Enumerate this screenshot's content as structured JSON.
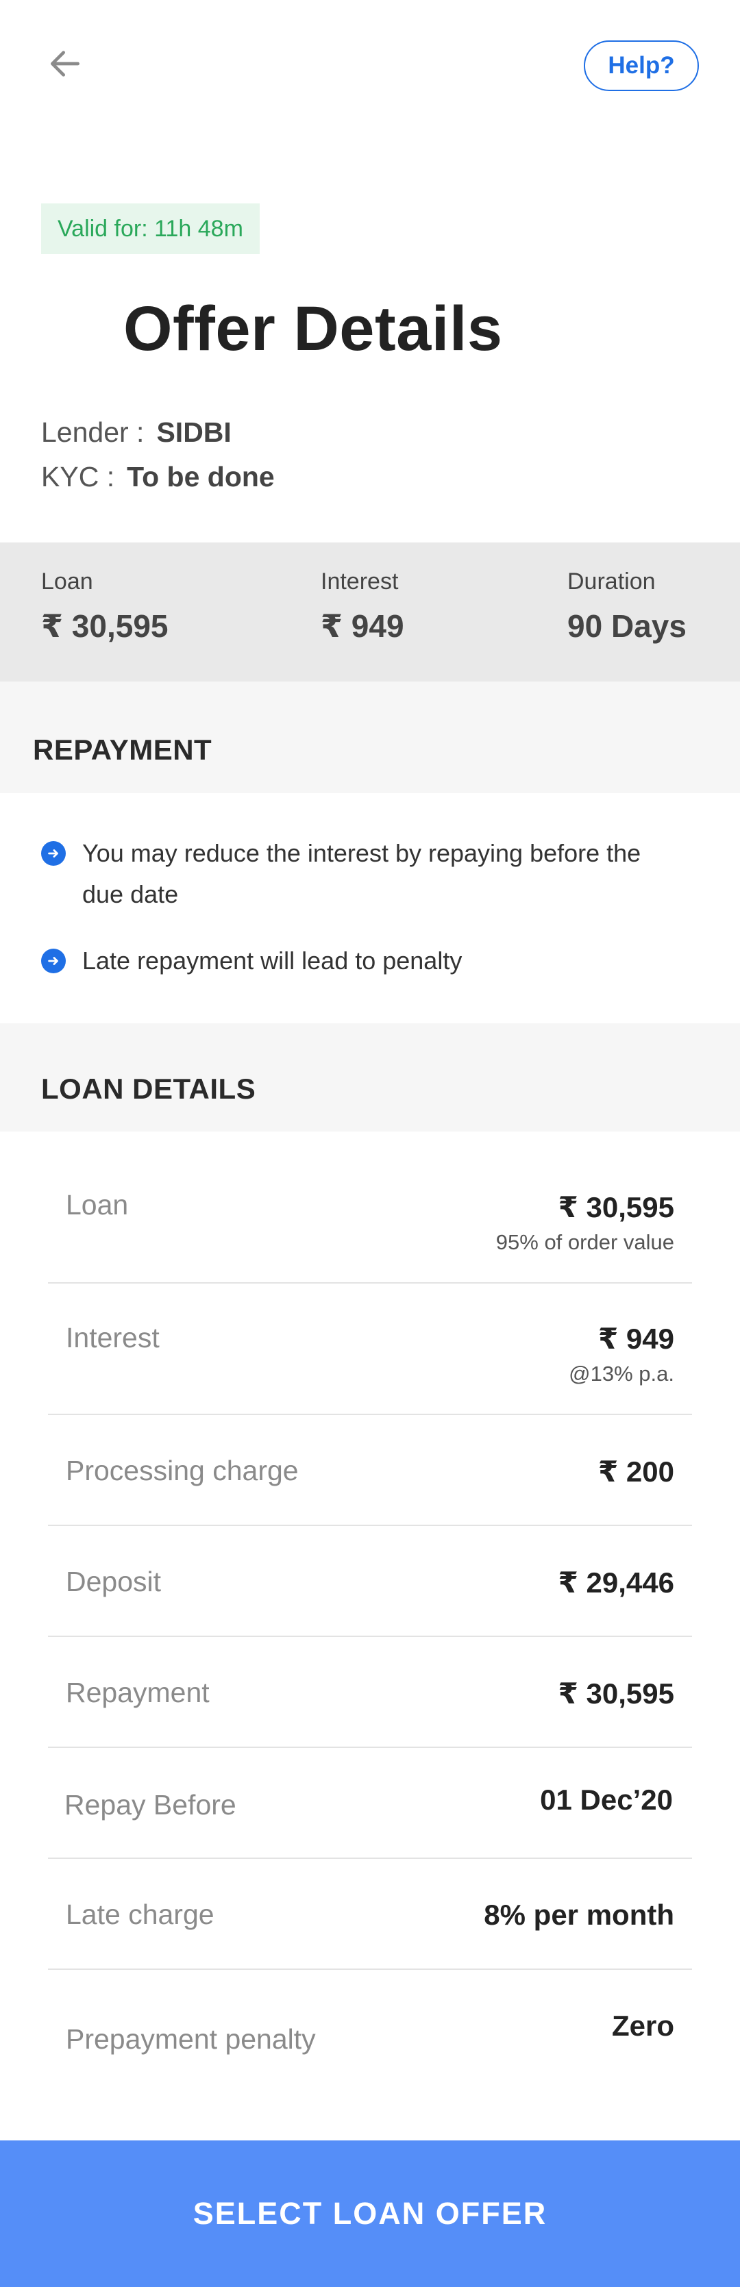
{
  "header": {
    "help_label": "Help?"
  },
  "offer": {
    "validity": "Valid for: 11h 48m",
    "title": "Offer Details",
    "lender_label": "Lender :",
    "lender_value": "SIDBI",
    "kyc_label": "KYC :",
    "kyc_value": "To be done"
  },
  "summary": [
    {
      "label": "Loan",
      "value": "₹ 30,595"
    },
    {
      "label": "Interest",
      "value": "₹ 949"
    },
    {
      "label": "Duration",
      "value": "90 Days"
    }
  ],
  "repayment": {
    "heading": "REPAYMENT",
    "notes": [
      "You may reduce the interest by repaying before the due date",
      "Late repayment will lead to penalty"
    ]
  },
  "loan_details": {
    "heading": "LOAN DETAILS",
    "rows": [
      {
        "label": "Loan",
        "value": "₹ 30,595",
        "sub": "95% of order value"
      },
      {
        "label": "Interest",
        "value": "₹ 949",
        "sub": "@13% p.a."
      },
      {
        "label": "Processing charge",
        "value": "₹ 200"
      },
      {
        "label": "Deposit",
        "value": "₹ 29,446"
      },
      {
        "label": "Repayment",
        "value": "₹ 30,595"
      },
      {
        "label": "Repay Before",
        "value": "01 Dec’20"
      },
      {
        "label": "Late charge",
        "value": "8% per month"
      },
      {
        "label": "Prepayment penalty",
        "value": "Zero"
      }
    ]
  },
  "cta": {
    "label": "SELECT LOAN OFFER"
  },
  "colors": {
    "accent": "#1f6fe5",
    "cta": "#558ef8",
    "valid_bg": "#e7f6ec",
    "valid_text": "#2aa85a"
  },
  "icons": {
    "back": "arrow-left-icon",
    "bullet": "arrow-right-circle-icon"
  }
}
